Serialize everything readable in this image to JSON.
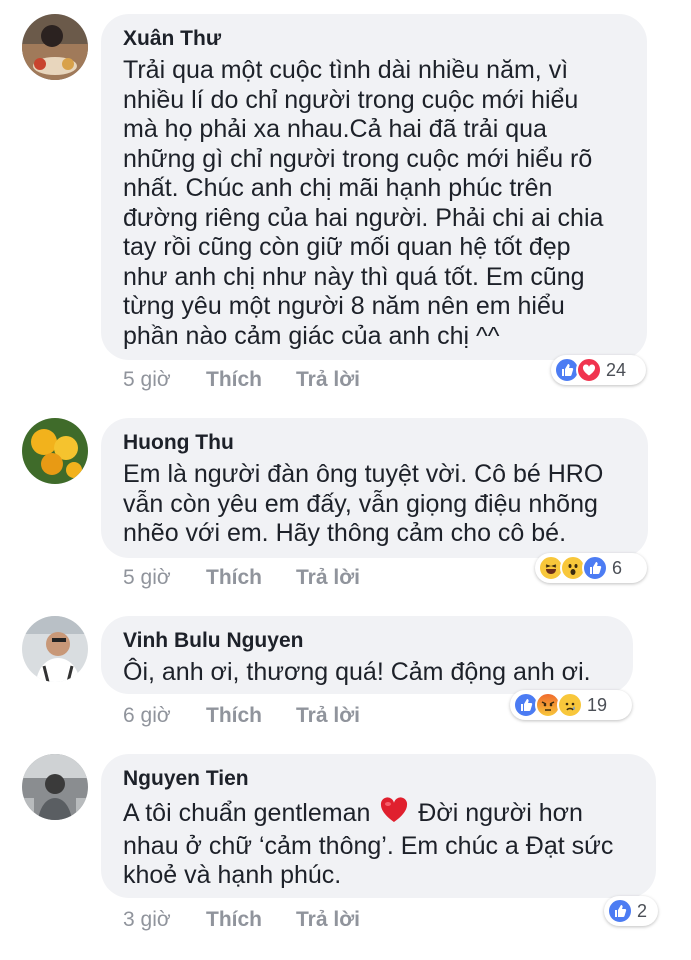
{
  "comments": [
    {
      "author": "Xuân Thư",
      "text": "Trải qua một cuộc tình dài nhiều năm, vì\nnhiều lí do chỉ người trong cuộc mới hiểu\nmà họ phải xa nhau.Cả hai đã trải qua\nnhững gì chỉ người trong cuộc mới hiểu rõ\nnhất. Chúc anh chị mãi hạnh phúc trên\nđường riêng của hai người. Phải chi ai chia\ntay rồi cũng còn giữ mối quan hệ tốt đẹp\nnhư anh chị như này thì quá tốt. Em cũng\ntừng yêu một người 8 năm nên em hiểu\nphần nào cảm giác của anh chị ^^",
      "time": "5 giờ",
      "like_label": "Thích",
      "reply_label": "Trả lời",
      "reactions": [
        "like-icon",
        "love-icon"
      ],
      "reaction_count": "24"
    },
    {
      "author": "Huong Thu",
      "text": "Em là người đàn ông tuyệt vời. Cô bé HRO\nvẫn còn yêu em đấy, vẫn giọng điệu nhõng\nnhẽo với em. Hãy thông cảm cho cô bé.",
      "time": "5 giờ",
      "like_label": "Thích",
      "reply_label": "Trả lời",
      "reactions": [
        "haha-icon",
        "wow-icon",
        "like-icon"
      ],
      "reaction_count": "6"
    },
    {
      "author": "Vinh Bulu Nguyen",
      "text": "Ôi, anh ơi, thương quá! Cảm động anh ơi.",
      "time": "6 giờ",
      "like_label": "Thích",
      "reply_label": "Trả lời",
      "reactions": [
        "like-icon",
        "angry-icon",
        "sad-icon"
      ],
      "reaction_count": "19"
    },
    {
      "author": "Nguyen Tien",
      "text_before_heart": "A tôi chuẩn gentleman ",
      "text_after_heart": " Đời người hơn\nnhau ở chữ ‘cảm thông’. Em chúc a Đạt sức\nkhoẻ và hạnh phúc.",
      "time": "3 giờ",
      "like_label": "Thích",
      "reply_label": "Trả lời",
      "reactions": [
        "like-icon"
      ],
      "reaction_count": "2"
    }
  ],
  "colors": {
    "bubble": "#f1f2f5",
    "meta_text": "#90949c",
    "like_blue": "#4c7cf3",
    "love_red": "#f0344f",
    "emoji_yellow": "#f8c73b"
  }
}
